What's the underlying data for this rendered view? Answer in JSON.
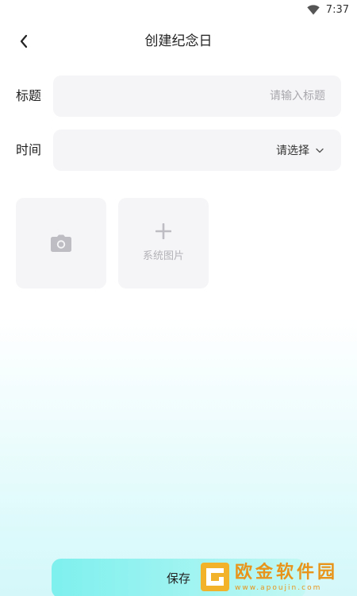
{
  "status_bar": {
    "time": "7:37",
    "icons": [
      "wifi-icon"
    ]
  },
  "header": {
    "title": "创建纪念日",
    "back_icon": "chevron-left-icon"
  },
  "form": {
    "title_label": "标题",
    "title_value": "",
    "title_placeholder": "请输入标题",
    "time_label": "时间",
    "time_value": "请选择",
    "time_icon": "chevron-down-icon"
  },
  "image_picker": {
    "camera_icon": "camera-icon",
    "system_icon": "plus-icon",
    "system_label": "系统图片"
  },
  "footer": {
    "save_label": "保存"
  },
  "watermark": {
    "name": "欧金软件园",
    "url": "www.apoujin.com"
  },
  "colors": {
    "accent": "#7ef0ee",
    "field_background": "#f5f5f7",
    "placeholder": "#a8a8ad",
    "watermark": "#e8941a"
  }
}
